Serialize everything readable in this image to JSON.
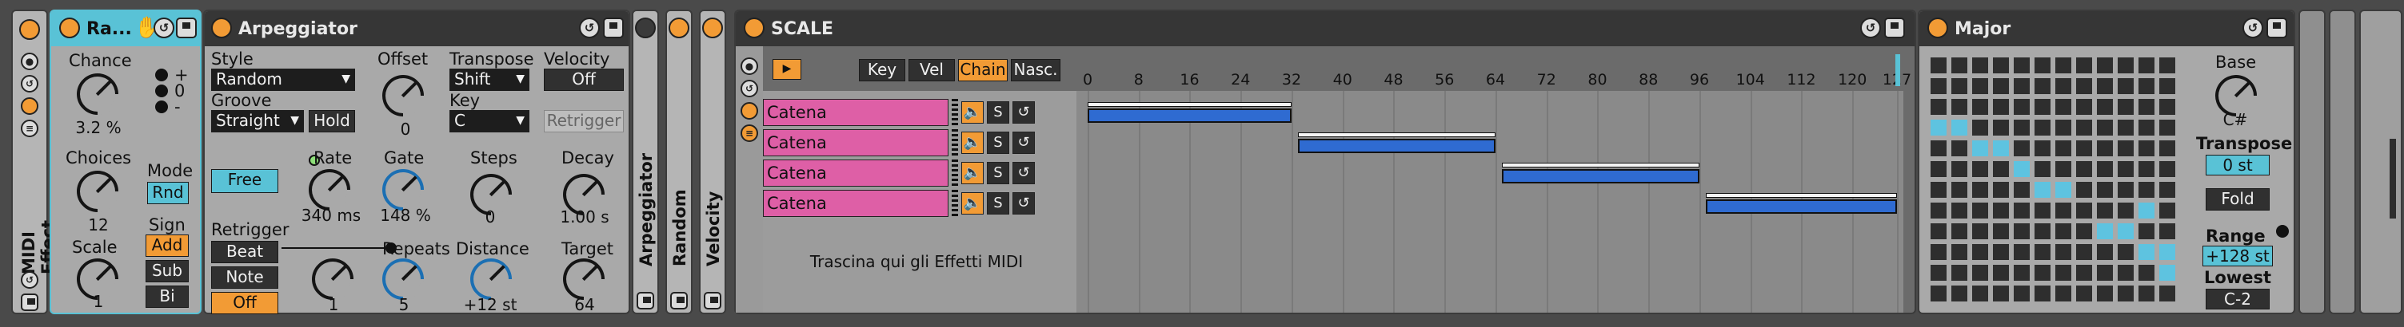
{
  "random": {
    "title": "Ra...",
    "chance_label": "Chance",
    "chance": "3.2 %",
    "choices_label": "Choices",
    "choices": "12",
    "scale_label": "Scale",
    "scale": "1",
    "mode_label": "Mode",
    "mode": "Rnd",
    "sign_label": "Sign",
    "sign_add": "Add",
    "sign_sub": "Sub",
    "sign_bi": "Bi",
    "plus": "+",
    "zero": "0",
    "minus": "-"
  },
  "rack": {
    "side_label": "MIDI Effect..."
  },
  "arp": {
    "title": "Arpeggiator",
    "style_label": "Style",
    "style": "Random",
    "groove_label": "Groove",
    "groove": "Straight",
    "hold": "Hold",
    "offset_label": "Offset",
    "offset": "0",
    "transpose_label": "Transpose",
    "transpose": "Shift",
    "key_label": "Key",
    "key": "C",
    "velocity_label": "Velocity",
    "velocity": "Off",
    "retrig_ghost": "Retrigger",
    "free": "Free",
    "rate_label": "Rate",
    "rate": "340 ms",
    "gate_label": "Gate",
    "gate": "148 %",
    "steps_label": "Steps",
    "steps": "0",
    "decay_label": "Decay",
    "decay": "1.00 s",
    "retrigger_label": "Retrigger",
    "beat": "Beat",
    "note": "Note",
    "off": "Off",
    "retrig_val": "1",
    "repeats_label": "Repeats",
    "repeats": "5",
    "distance_label": "Distance",
    "distance": "+12 st",
    "target_label": "Target",
    "target": "64"
  },
  "folded": [
    {
      "label": "Arpeggiator"
    },
    {
      "label": "Random"
    },
    {
      "label": "Velocity"
    }
  ],
  "scale_rack": {
    "title": "SCALE",
    "key": "Key",
    "vel": "Vel",
    "chain": "Chain",
    "hide": "Nasc.",
    "ticks": [
      "0",
      "8",
      "16",
      "24",
      "32",
      "40",
      "48",
      "56",
      "64",
      "72",
      "80",
      "88",
      "96",
      "104",
      "112",
      "120",
      "127"
    ],
    "chains": [
      {
        "name": "Catena",
        "s": "S",
        "zone": [
          0,
          32
        ]
      },
      {
        "name": "Catena",
        "s": "S",
        "zone": [
          33,
          64
        ]
      },
      {
        "name": "Catena",
        "s": "S",
        "zone": [
          65,
          96
        ]
      },
      {
        "name": "Catena",
        "s": "S",
        "zone": [
          97,
          127
        ]
      }
    ],
    "drop_hint": "Trascina qui gli Effetti MIDI"
  },
  "major": {
    "title": "Major",
    "base_label": "Base",
    "base": "C#",
    "transpose_label": "Transpose",
    "transpose": "0 st",
    "fold": "Fold",
    "range_label": "Range",
    "range": "+128 st",
    "lowest_label": "Lowest",
    "lowest": "C-2",
    "active_cells": [
      [
        10,
        11
      ],
      [
        9,
        10
      ],
      [
        9,
        11
      ],
      [
        8,
        8
      ],
      [
        8,
        9
      ],
      [
        7,
        10
      ],
      [
        6,
        5
      ],
      [
        6,
        6
      ],
      [
        5,
        4
      ],
      [
        4,
        2
      ],
      [
        4,
        3
      ],
      [
        3,
        0
      ],
      [
        3,
        1
      ]
    ]
  },
  "colors": {
    "accent": "#f29b35",
    "pink": "#de5fa6",
    "blue": "#2f6bd1",
    "cyan": "#5ec3e0"
  }
}
